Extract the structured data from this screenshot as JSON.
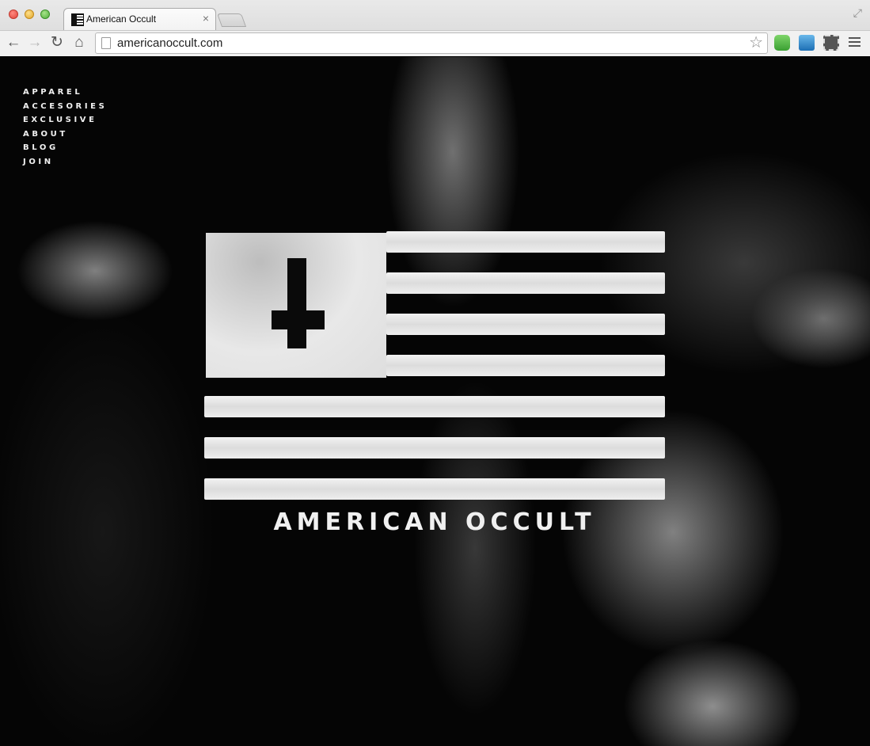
{
  "browser": {
    "tab_title": "American Occult",
    "tab_close": "×",
    "url": "americanoccult.com",
    "icons": {
      "back": "←",
      "forward": "→",
      "reload": "↻",
      "home": "⌂",
      "star": "☆",
      "fullscreen": "⤢"
    }
  },
  "nav": {
    "items": [
      "APPAREL",
      "ACCESORIES",
      "EXCLUSIVE",
      "ABOUT",
      "BLOG",
      "JOIN"
    ]
  },
  "logo": {
    "brand": "AMERICAN OCCULT"
  },
  "colors": {
    "background": "#050505",
    "foreground": "#f0f0f0"
  }
}
